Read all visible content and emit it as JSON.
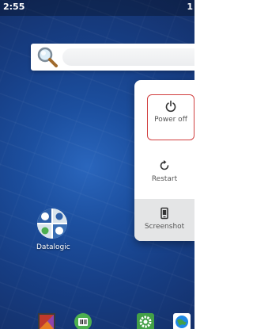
{
  "status_bar": {
    "time": "2:55",
    "right_partial": "1"
  },
  "search_widget": {
    "placeholder": ""
  },
  "power_menu": {
    "items": [
      {
        "label": "Power off",
        "icon": "power-icon",
        "highlighted": true
      },
      {
        "label": "Restart",
        "icon": "restart-icon"
      },
      {
        "label": "Screenshot",
        "icon": "screenshot-icon"
      }
    ],
    "highlight_color": "#d13f3f"
  },
  "home_apps": [
    {
      "label": "Datalogic",
      "icon": "datalogic-tools-icon"
    }
  ],
  "dock": {
    "apps": [
      {
        "icon": "gallery-icon"
      },
      {
        "icon": "barcode-scanner-icon"
      },
      {
        "icon": "settings-icon"
      },
      {
        "icon": "browser-globe-icon"
      }
    ]
  },
  "colors": {
    "wallpaper": "#1c4f9f",
    "menu_background": "#ffffff",
    "screenshot_row": "#e4e5e6"
  }
}
